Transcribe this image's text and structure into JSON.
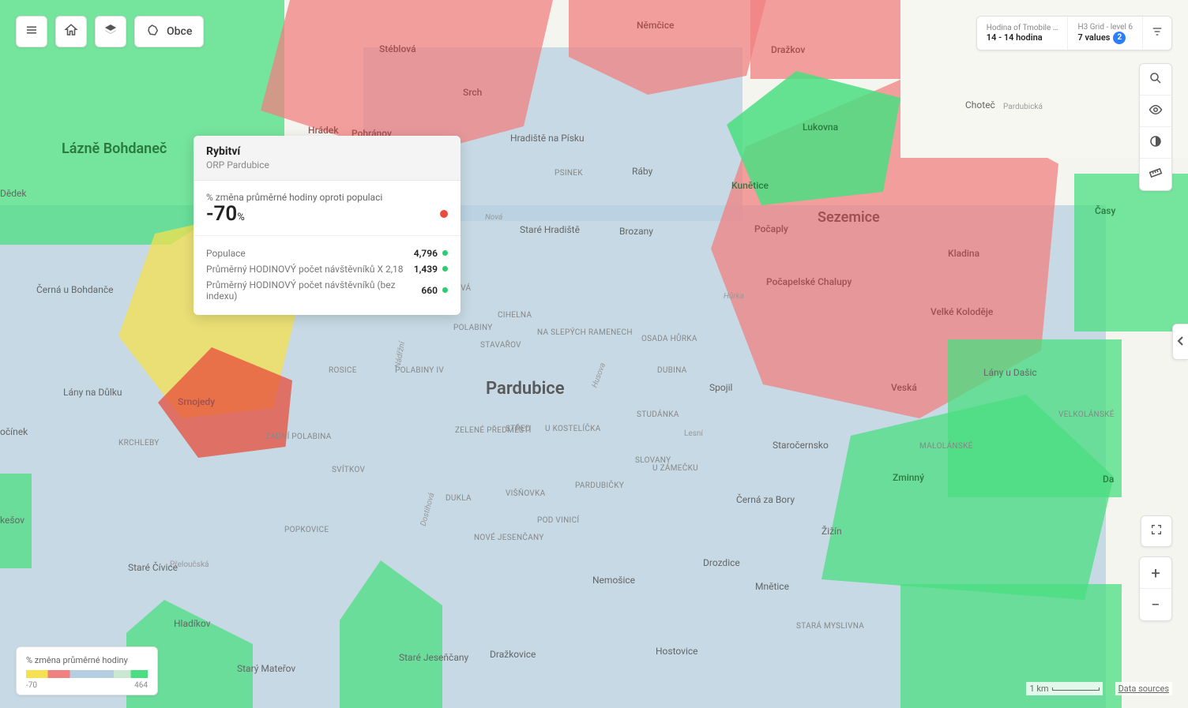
{
  "toolbar": {
    "obce_label": "Obce"
  },
  "filters": {
    "left": {
      "label": "Hodina of Tmobile …",
      "value": "14 - 14 hodina"
    },
    "right": {
      "label": "H3 Grid - level 6",
      "value": "7 values",
      "badge": "2"
    }
  },
  "legend": {
    "title": "% změna průměrné hodiny",
    "min": "-70",
    "max": "464"
  },
  "scale": {
    "label": "1 km"
  },
  "datasources": "Data sources",
  "popup": {
    "title": "Rybitví",
    "subtitle": "ORP Pardubice",
    "metric_label": "% změna průměrné hodiny oproti populaci",
    "metric_value": "-70",
    "metric_unit": "%",
    "stats": [
      {
        "label": "Populace",
        "value": "4,796"
      },
      {
        "label": "Průměrný HODINOVÝ počet návštěvníků X 2,18",
        "value": "1,439"
      },
      {
        "label": "Průměrný HODINOVÝ počet návštěvníků (bez indexu)",
        "value": "660"
      }
    ]
  },
  "labels": {
    "city_main": "Pardubice",
    "city_sez": "Sezemice",
    "city_lb": "Lázně Bohdaneč",
    "towns_red": {
      "stebl": "Stéblová",
      "nemc": "Němčice",
      "drazkov": "Dražkov",
      "srch": "Srch",
      "hradek": "Hrádek",
      "pohranov": "Pohránov",
      "smo": "Srnojedy",
      "pocaply": "Počaply",
      "kladina": "Kladina",
      "pocch": "Počapelské Chalupy",
      "vkol": "Velké Koloděje",
      "veska": "Veská"
    },
    "towns_green": {
      "lukovna": "Lukovna",
      "kunetice": "Kunětice",
      "zminny": "Zminný",
      "casov": "Časy",
      "dan": "Da",
      "malol": "MAŁOLÁNSKÉ",
      "velkol": "VELKOLÁNSKÉ",
      "lanydas": "Lány u Dašic"
    },
    "towns_plain": {
      "dedek": "Dědek",
      "chotec": "Choteč",
      "pardubicka": "Pardubická",
      "cub": "Černá u Bohdanče",
      "lndulku": "Lány na Důlku",
      "ocinek": "očínek",
      "krchleby": "KRCHLEBY",
      "kesov": "kešov",
      "preloucska": "Přeloučská",
      "hladikov": "Hladíkov",
      "starymat": "Starý Mateřov",
      "starejes": "Staré Jeseňčany",
      "drazkovice": "Dražkovice",
      "nemosice": "Nemošice",
      "hostovice": "Hostovice",
      "drozdice": "Drozdice",
      "mnetice": "Mnětice",
      "zizin": "Žižín",
      "staramys": "STARÁ MYSLIVNA",
      "cernazb": "Černá za Bory",
      "starehrad": "Staré Hradiště",
      "brozany": "Brozany",
      "raby": "Ráby",
      "psinek": "PSINEK",
      "hradiste": "Hradiště na Písku",
      "starocer": "Staročernsko",
      "spojil": "Spojil",
      "starecivice": "Staré Čívice"
    },
    "districts": {
      "rosice": "ROSICE",
      "trnova": "TRNOVÁ",
      "cihelna": "CIHELNA",
      "polabiny": "POLABINY",
      "polabiv": "POLABINY IV",
      "stavarov": "STAVAŘOV",
      "naslep": "NA SLEPÝCH RAMENECH",
      "osadah": "OSADA HŮRKA",
      "dubina": "DUBINA",
      "studanka": "STUDÁNKA",
      "stred": "STŘED",
      "ukost": "U KOSTELÍČKA",
      "zelpre": "ZELENÉ PŘEDMĚSTÍ",
      "slovany": "SLOVANY",
      "uzam": "U ZÁMEČKU",
      "lesni": "Lesní",
      "svitkov": "SVÍTKOV",
      "dukla": "DUKLA",
      "visnovka": "VIŠŇOVKA",
      "pardubicky": "PARDUBIČKY",
      "podvinici": "POD VINICÍ",
      "novejes": "NOVÉ JESENČANY",
      "popkovice": "POPKOVICE",
      "zadpol": "ZADNÍ POLABINA"
    },
    "rivers": {
      "nova": "Nová",
      "hurka": "Hůrka",
      "husova": "Husova",
      "nadrzni": "Nádřžní",
      "dostihova": "Dostihová"
    }
  }
}
